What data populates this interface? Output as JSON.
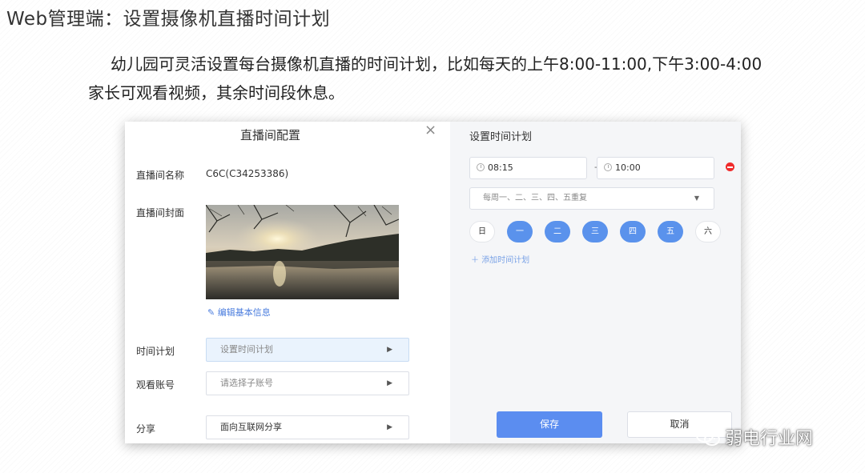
{
  "slide": {
    "title": "Web管理端：设置摄像机直播时间计划",
    "intro": "幼儿园可灵活设置每台摄像机直播的时间计划，比如每天的上午8:00-11:00,下午3:00-4:00家长可观看视频，其余时间段休息。"
  },
  "dialog": {
    "title": "直播间配置",
    "close": "×",
    "fields": {
      "name_label": "直播间名称",
      "name_value": "C6C(C34253386)",
      "cover_label": "直播间封面",
      "edit_link": "编辑基本信息",
      "schedule_label": "时间计划",
      "schedule_value": "设置时间计划",
      "account_label": "观看账号",
      "account_placeholder": "请选择子账号",
      "share_label": "分享",
      "share_value": "面向互联网分享"
    }
  },
  "schedule_panel": {
    "title": "设置时间计划",
    "start_time": "08:15",
    "separator": "-",
    "end_time": "10:00",
    "repeat": "每周一、二、三、四、五重复",
    "days": [
      {
        "label": "日",
        "selected": false
      },
      {
        "label": "一",
        "selected": true
      },
      {
        "label": "二",
        "selected": true
      },
      {
        "label": "三",
        "selected": true
      },
      {
        "label": "四",
        "selected": true
      },
      {
        "label": "五",
        "selected": true
      },
      {
        "label": "六",
        "selected": false
      }
    ],
    "add_plan": "添加时间计划",
    "save": "保存",
    "cancel": "取消"
  },
  "watermark": "弱电行业网",
  "colors": {
    "accent": "#5b8df0",
    "day_selected": "#5a92ec",
    "remove": "#f02b2b",
    "link": "#4a7cde"
  }
}
